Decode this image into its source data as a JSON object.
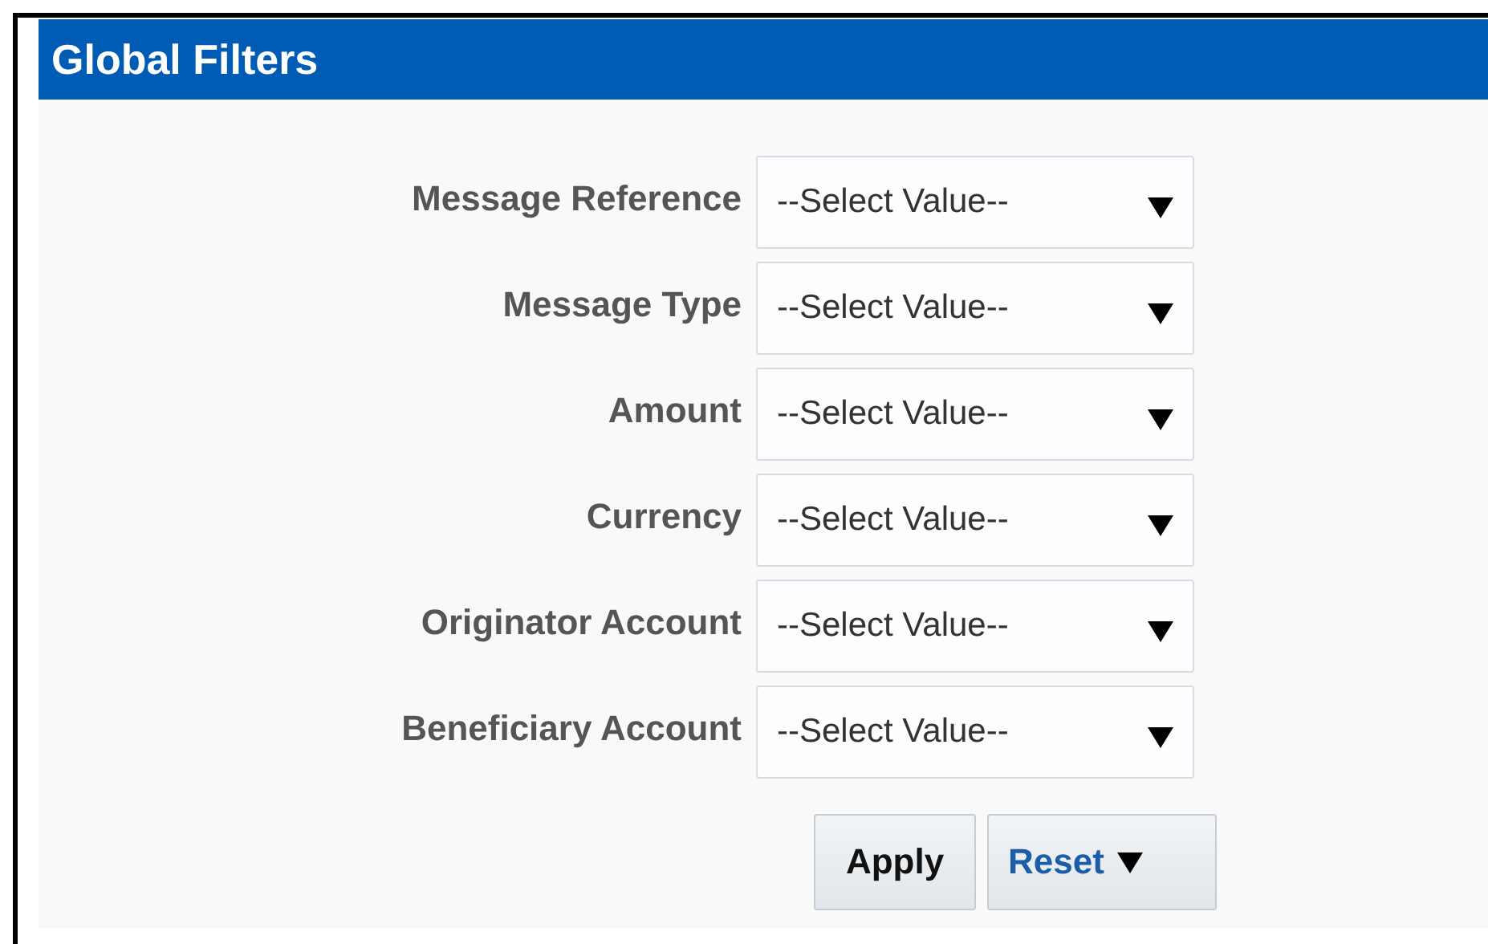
{
  "panel": {
    "title": "Global Filters"
  },
  "filters": [
    {
      "label": "Message Reference",
      "value": "--Select Value--"
    },
    {
      "label": "Message Type",
      "value": "--Select Value--"
    },
    {
      "label": "Amount",
      "value": "--Select Value--"
    },
    {
      "label": "Currency",
      "value": "--Select Value--"
    },
    {
      "label": "Originator Account",
      "value": "--Select Value--"
    },
    {
      "label": "Beneficiary Account",
      "value": "--Select Value--"
    }
  ],
  "buttons": [
    {
      "kind": "plain",
      "label": "Apply"
    },
    {
      "kind": "menu",
      "label": "Reset"
    }
  ]
}
